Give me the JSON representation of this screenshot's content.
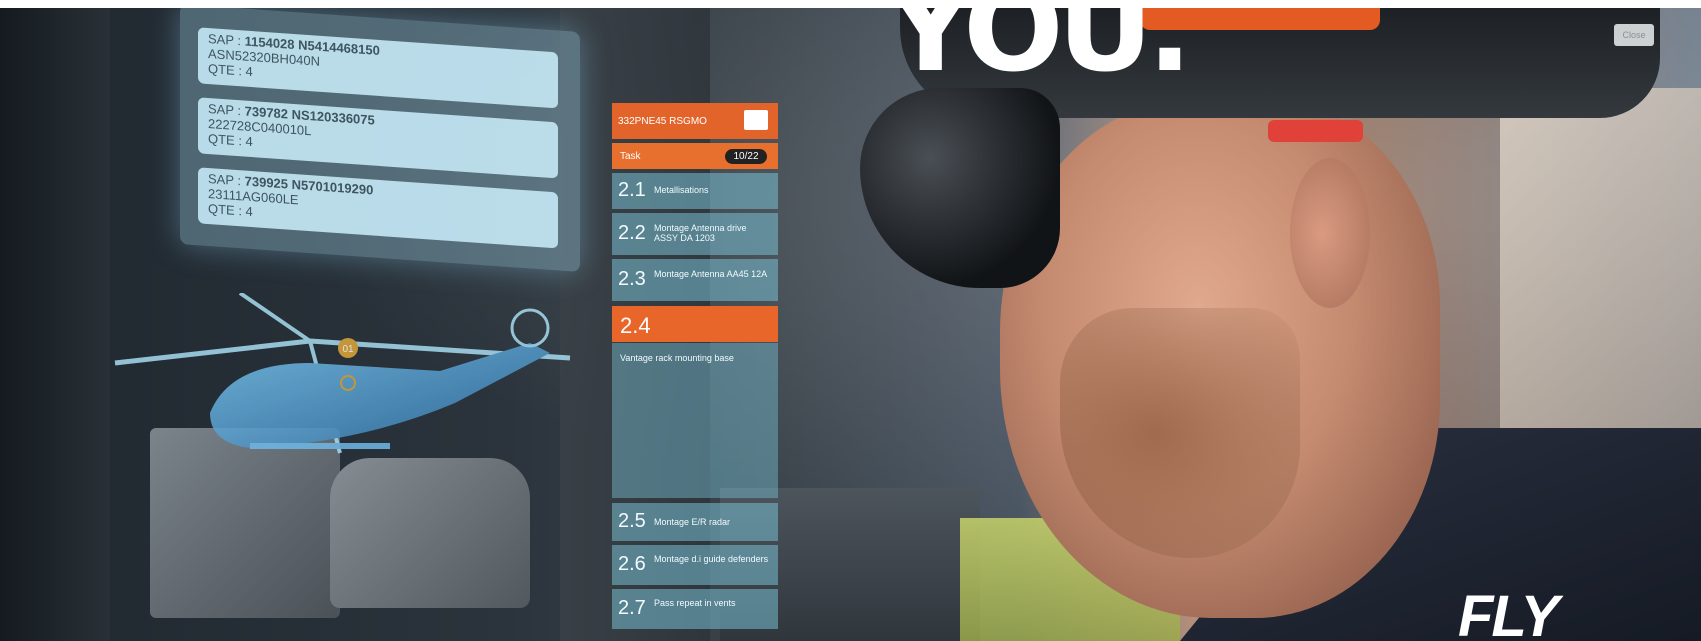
{
  "headline": "YOU.",
  "tagline": "FLY",
  "close_label": "Close",
  "sap_entries": [
    {
      "sap_prefix": "SAP : ",
      "sap_code": "1154028 N5414468150",
      "part": "ASN52320BH040N",
      "qty": "QTE : 4"
    },
    {
      "sap_prefix": "SAP : ",
      "sap_code": "739782 NS120336075",
      "part": "222728C040010L",
      "qty": "QTE : 4"
    },
    {
      "sap_prefix": "SAP : ",
      "sap_code": "739925 N5701019290",
      "part": "23111AG060LE",
      "qty": "QTE : 4"
    }
  ],
  "task_panel": {
    "title": "332PNE45 RSGMO",
    "task_label": "Task",
    "task_count": "10/22",
    "items_top": [
      {
        "num": "2.1",
        "label": "Metallisations"
      },
      {
        "num": "2.2",
        "label": "Montage Antenna drive ASSY DA 1203"
      },
      {
        "num": "2.3",
        "label": "Montage Antenna AA45 12A"
      }
    ],
    "active": {
      "num": "2.4",
      "label": "Vantage rack mounting base"
    },
    "items_bottom": [
      {
        "num": "2.5",
        "label": "Montage E/R radar"
      },
      {
        "num": "2.6",
        "label": "Montage d.i guide defenders"
      },
      {
        "num": "2.7",
        "label": "Pass repeat in vents"
      }
    ]
  },
  "hologram_marker": "01",
  "colors": {
    "accent_orange": "#e3642a",
    "hologram_blue": "#a7dcf0"
  }
}
